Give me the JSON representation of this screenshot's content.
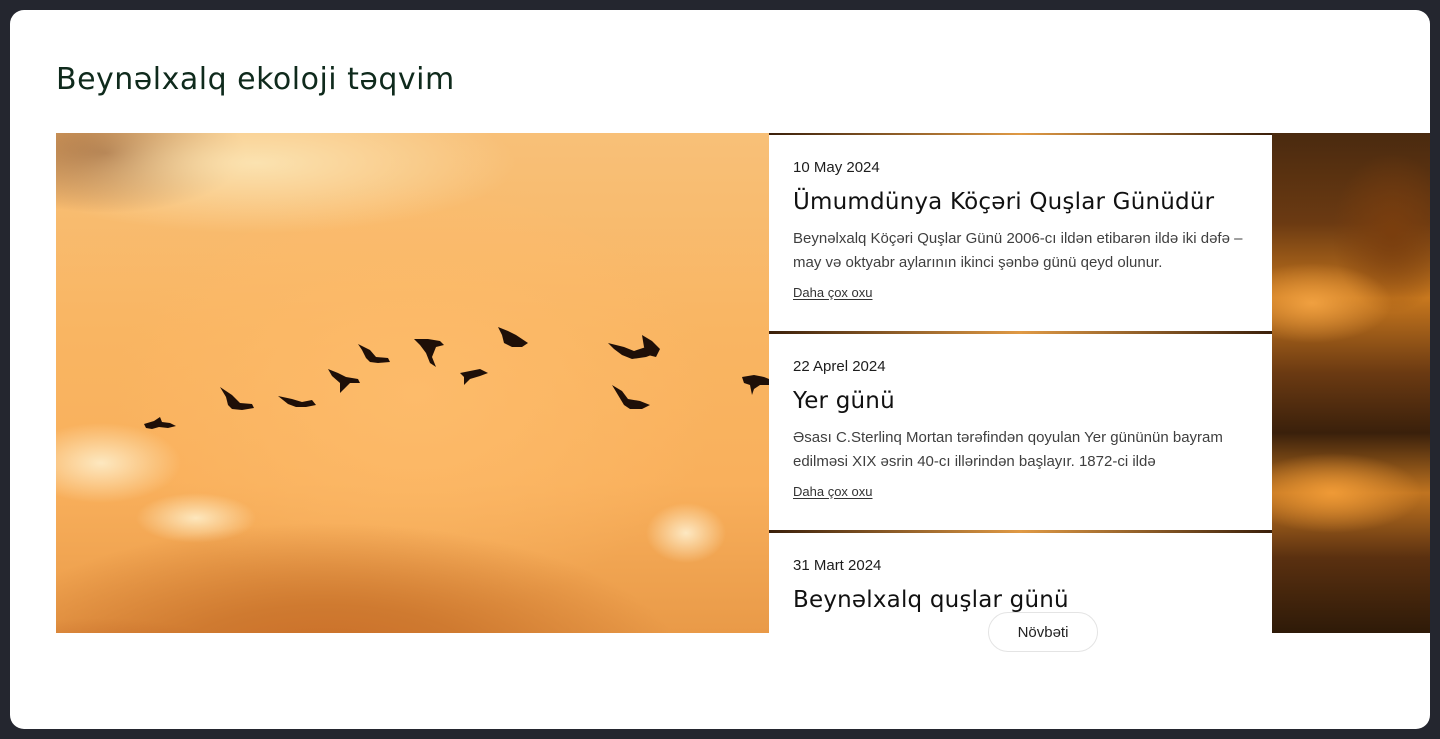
{
  "section": {
    "title": "Beynəlxalq ekoloji təqvim"
  },
  "events": [
    {
      "date": "10 May 2024",
      "title": "Ümumdünya Köçəri Quşlar Günüdür",
      "description": "Beynəlxalq Köçəri Quşlar Günü 2006-cı ildən etibarən ildə iki dəfə – may və oktyabr aylarının ikinci şənbə günü qeyd olunur.",
      "link": "Daha çox oxu"
    },
    {
      "date": "22 Aprel 2024",
      "title": "Yer günü",
      "description": "Əsası C.Sterlinq Mortan tərəfindən qoyulan Yer gününün bayram edilməsi XIX əsrin 40-cı illərindən başlayır. 1872-ci ildə",
      "link": "Daha çox oxu"
    },
    {
      "date": "31 Mart 2024",
      "title": "Beynəlxalq quşlar günü"
    }
  ],
  "controls": {
    "next_label": "Növbəti"
  },
  "colors": {
    "title": "#0f2a1c",
    "sky": "#f9b562",
    "card": "#ffffff"
  },
  "icons": {
    "hero_image": "flying-geese-sunset-image",
    "side_image": "sunset-clouds-image"
  }
}
